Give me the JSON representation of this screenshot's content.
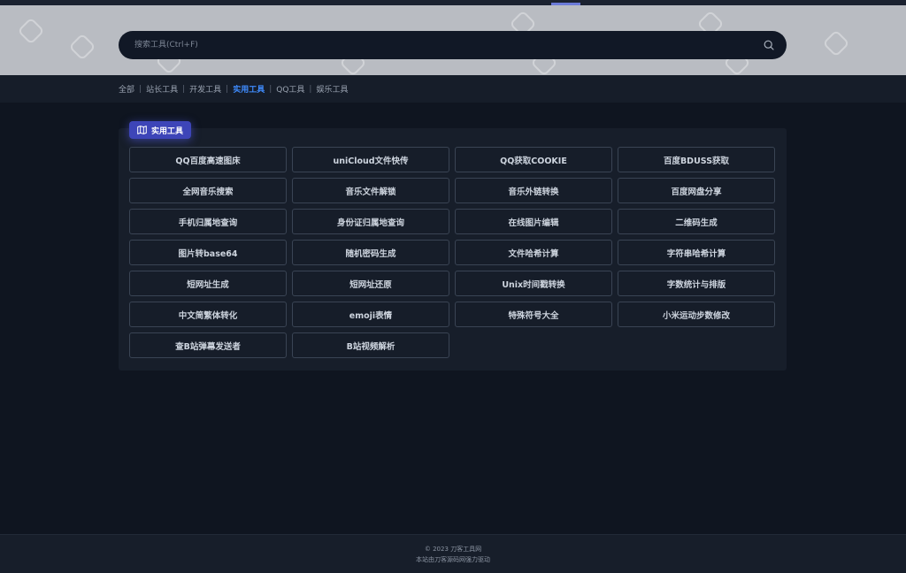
{
  "search": {
    "placeholder": "搜索工具(Ctrl+F)",
    "icon": "search-icon"
  },
  "nav": {
    "items": [
      {
        "label": "全部",
        "active": false
      },
      {
        "label": "站长工具",
        "active": false
      },
      {
        "label": "开发工具",
        "active": false
      },
      {
        "label": "实用工具",
        "active": true
      },
      {
        "label": "QQ工具",
        "active": false
      },
      {
        "label": "娱乐工具",
        "active": false
      }
    ],
    "separator": "|",
    "active_color": "#3f8cff"
  },
  "panel": {
    "badge_label": "实用工具",
    "badge_icon": "map-icon",
    "badge_color": "#3d45b8",
    "tools": [
      "QQ百度高速图床",
      "uniCloud文件快传",
      "QQ获取COOKIE",
      "百度BDUSS获取",
      "全网音乐搜索",
      "音乐文件解锁",
      "音乐外链转换",
      "百度网盘分享",
      "手机归属地查询",
      "身份证归属地查询",
      "在线图片编辑",
      "二维码生成",
      "图片转base64",
      "随机密码生成",
      "文件哈希计算",
      "字符串哈希计算",
      "短网址生成",
      "短网址还原",
      "Unix时间戳转换",
      "字数统计与排版",
      "中文简繁体转化",
      "emoji表情",
      "特殊符号大全",
      "小米运动步数修改",
      "查B站弹幕发送者",
      "B站视频解析"
    ]
  },
  "footer": {
    "copyright": "© 2023 刀客工具网",
    "powered": "本站由刀客源码网强力驱动"
  }
}
